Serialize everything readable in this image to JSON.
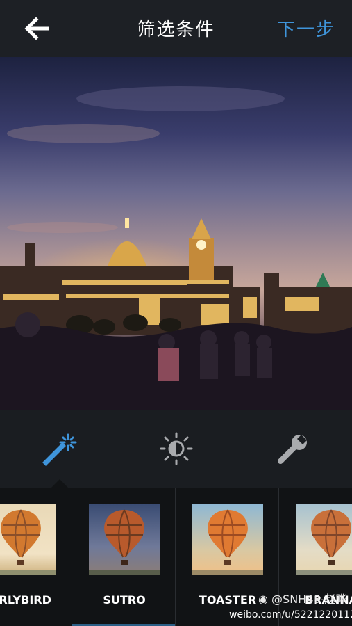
{
  "header": {
    "title": "筛选条件",
    "next_label": "下一步"
  },
  "tools": [
    {
      "name": "magic-wand-icon",
      "active": true
    },
    {
      "name": "brightness-icon",
      "active": false
    },
    {
      "name": "wrench-icon",
      "active": false
    }
  ],
  "filters": [
    {
      "label": "EARLYBIRD",
      "display": "ARLYBIRD"
    },
    {
      "label": "SUTRO",
      "display": "SUTRO"
    },
    {
      "label": "TOASTER",
      "display": "TOASTER"
    },
    {
      "label": "BRANNAN",
      "display": "BRANNA"
    }
  ],
  "watermark": {
    "line1": "@SNH48-赵晔",
    "line2": "weibo.com/u/5221220112"
  },
  "colors": {
    "accent": "#3f95db",
    "bar_bg": "#1d2025",
    "strip_bg": "#111315"
  }
}
